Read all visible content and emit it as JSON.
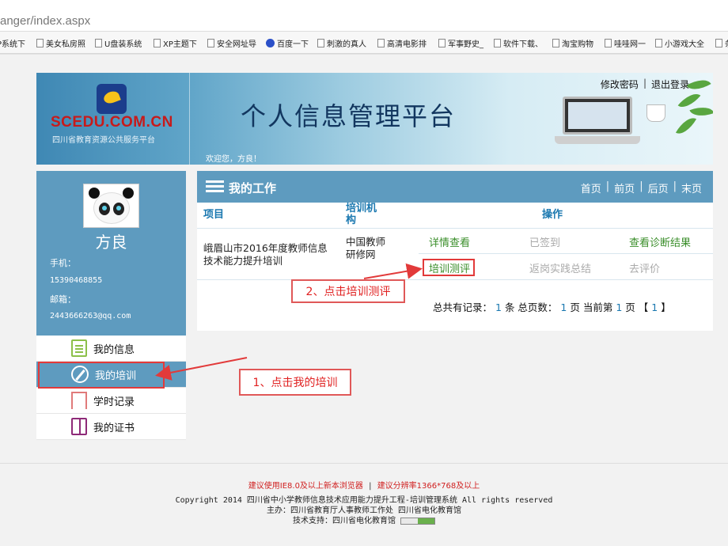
{
  "browser": {
    "url": "anger/index.aspx",
    "bookmarks": [
      {
        "label": "P系统下",
        "icon": "doc-icon"
      },
      {
        "label": "美女私房照",
        "icon": "doc-icon"
      },
      {
        "label": "U盘装系统",
        "icon": "doc-icon"
      },
      {
        "label": "XP主题下",
        "icon": "doc-icon"
      },
      {
        "label": "安全网址导",
        "icon": "doc-icon"
      },
      {
        "label": "百度一下",
        "icon": "paw-icon"
      },
      {
        "label": "刺激的真人",
        "icon": "doc-icon"
      },
      {
        "label": "高清电影排",
        "icon": "doc-icon"
      },
      {
        "label": "军事野史_",
        "icon": "doc-icon"
      },
      {
        "label": "软件下载、",
        "icon": "doc-icon"
      },
      {
        "label": "淘宝购物",
        "icon": "doc-icon"
      },
      {
        "label": "哇哇网一",
        "icon": "doc-icon"
      },
      {
        "label": "小游戏大全",
        "icon": "doc-icon"
      },
      {
        "label": "条",
        "icon": "doc-icon"
      }
    ]
  },
  "header": {
    "logo_text": "SCEDU.COM.CN",
    "logo_sub": "四川省教育资源公共服务平台",
    "title": "个人信息管理平台",
    "welcome": "欢迎您，方良！",
    "change_password": "修改密码",
    "logout": "退出登录"
  },
  "profile": {
    "name": "方良",
    "phone_label": "手机：",
    "phone": "15390468855",
    "email_label": "邮箱：",
    "email": "2443666263@qq.com"
  },
  "menu": [
    {
      "label": "我的信息",
      "icon": "clipboard-icon"
    },
    {
      "label": "我的培训",
      "icon": "pencil-icon",
      "active": true
    },
    {
      "label": "学时记录",
      "icon": "bookmark-icon"
    },
    {
      "label": "我的证书",
      "icon": "book-icon"
    }
  ],
  "work": {
    "title": "我的工作",
    "pager": {
      "first": "首页",
      "prev": "前页",
      "next": "后页",
      "last": "末页"
    },
    "columns": {
      "project": "项目",
      "org": "培训机构",
      "ops": "操作"
    },
    "row": {
      "project": "峨眉山市2016年度教师信息技术能力提升培训",
      "org": "中国教师研修网",
      "ops": {
        "detail": "详情查看",
        "signed": "已签到",
        "diagnosis": "查看诊断结果",
        "assessment": "培训测评",
        "summary": "返岗实践总结",
        "evaluate": "去评价"
      }
    },
    "summary": {
      "total_label": "总共有记录：",
      "total": "1",
      "unit_rows": "条 总页数：",
      "pages": "1",
      "unit_pages": "页 当前第",
      "current": "1",
      "unit_current": "页",
      "bracket_open": "【",
      "page_link": "1",
      "bracket_close": "】"
    }
  },
  "annotations": {
    "step1": "1、点击我的培训",
    "step2": "2、点击培训测评"
  },
  "footer": {
    "browser_tip": "建议使用IE8.0及以上新本浏览器",
    "resolution_tip": "建议分辨率1366*768及以上",
    "copyright": "Copyright 2014 四川省中小学教师信息技术应用能力提升工程-培训管理系统 All rights reserved",
    "host": "主办：四川省教育厅人事教师工作处 四川省电化教育馆",
    "tech": "技术支持：四川省电化教育馆",
    "counter_label": "CNZZ"
  },
  "colors": {
    "accent": "#5e9bbf",
    "link": "#1a78b0",
    "green": "#3a8e2a",
    "annotation": "#e02020"
  }
}
